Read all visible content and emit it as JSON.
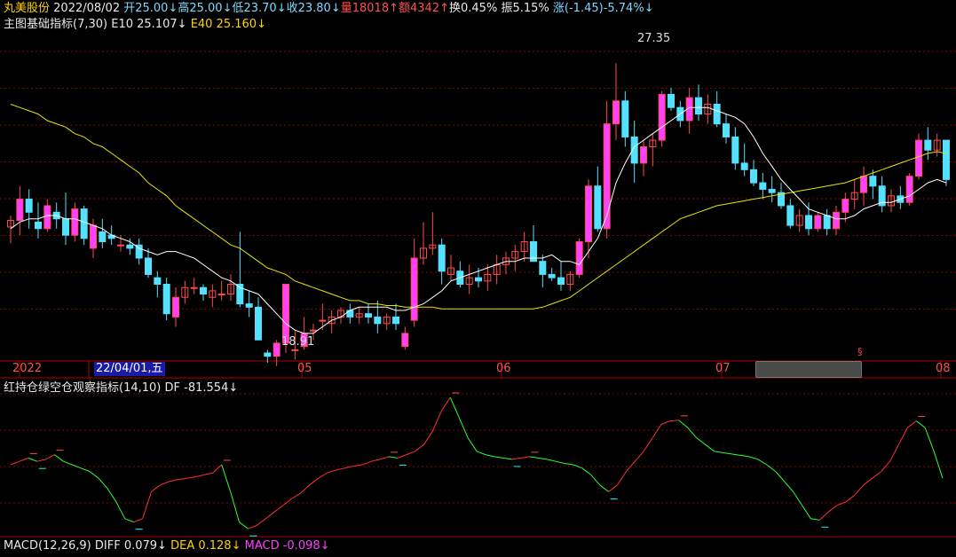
{
  "header": {
    "stock_name": "丸美股份",
    "date": "2022/08/02",
    "open": "开25.00",
    "open_arrow": "↓",
    "high": "高25.00",
    "high_arrow": "↓",
    "low": "低23.70",
    "low_arrow": "↓",
    "close": "收23.80",
    "close_arrow": "↓",
    "volume": "量18018",
    "volume_arrow": "↑",
    "amount": "额4342",
    "amount_arrow": "↑",
    "turnover": "换0.45%",
    "amplitude": "振5.15%",
    "change": "涨(-1.45)-5.74%",
    "change_arrow": "↓"
  },
  "main_indicator": {
    "name": "主图基础指标(7,30)",
    "e10_label": "E10",
    "e10_value": "25.107",
    "e10_arrow": "↓",
    "e40_label": "E40",
    "e40_value": "25.160",
    "e40_arrow": "↓"
  },
  "annotations": {
    "high_label": "27.35",
    "low_label": "18.91",
    "marker": "§"
  },
  "x_axis": {
    "year_label": "2022",
    "cursor_date": "22/04/01,五",
    "month_labels": [
      "05",
      "06",
      "07",
      "08"
    ]
  },
  "sub_indicator": {
    "name": "红持仓绿空仓观察指标(14,10)",
    "df_label": "DF",
    "df_value": "-81.554",
    "df_arrow": "↓"
  },
  "macd": {
    "name": "MACD(12,26,9)",
    "diff_label": "DIFF",
    "diff_value": "0.079",
    "diff_arrow": "↓",
    "dea_label": "DEA",
    "dea_value": "0.128",
    "dea_arrow": "↓",
    "macd_label": "MACD",
    "macd_value": "-0.098",
    "macd_arrow": "↓"
  },
  "colors": {
    "up": "#ff4a4a",
    "down": "#54e0ff",
    "up_fill": "#ff40ff",
    "ma_short": "#ffffff",
    "ma_long": "#e6e600",
    "grid": "#8a0000",
    "osc_up": "#ff3030",
    "osc_down": "#30ff30",
    "dash": "#00ffff"
  },
  "chart_data": [
    {
      "type": "candlestick",
      "title": "丸美股份 主图",
      "y_range": [
        18.5,
        28.2
      ],
      "grid": true,
      "candles": [
        [
          22.35,
          22.7,
          21.85,
          22.55
        ],
        [
          22.55,
          23.6,
          22.1,
          23.2
        ],
        [
          23.2,
          23.5,
          22.3,
          22.8
        ],
        [
          22.5,
          23.1,
          22.0,
          22.3
        ],
        [
          22.3,
          23.2,
          22.2,
          23.0
        ],
        [
          22.8,
          23.1,
          22.3,
          22.6
        ],
        [
          22.6,
          23.4,
          21.8,
          22.1
        ],
        [
          22.1,
          23.1,
          21.9,
          22.9
        ],
        [
          22.9,
          23.0,
          21.8,
          22.0
        ],
        [
          21.7,
          22.6,
          21.4,
          22.4
        ],
        [
          22.2,
          22.6,
          21.7,
          21.9
        ],
        [
          22.1,
          22.4,
          21.8,
          22.0
        ],
        [
          21.8,
          22.1,
          21.6,
          21.8
        ],
        [
          21.8,
          22.0,
          21.5,
          21.7
        ],
        [
          21.8,
          22.0,
          21.2,
          21.4
        ],
        [
          21.4,
          21.7,
          20.8,
          20.9
        ],
        [
          20.8,
          21.0,
          20.2,
          20.6
        ],
        [
          20.6,
          20.8,
          19.5,
          19.7
        ],
        [
          19.6,
          20.5,
          19.3,
          20.2
        ],
        [
          20.2,
          20.7,
          20.0,
          20.5
        ],
        [
          20.5,
          20.8,
          20.3,
          20.5
        ],
        [
          20.5,
          20.6,
          20.1,
          20.3
        ],
        [
          20.2,
          20.6,
          19.9,
          20.4
        ],
        [
          20.3,
          20.7,
          20.1,
          20.3
        ],
        [
          20.3,
          20.9,
          20.1,
          20.6
        ],
        [
          20.6,
          22.2,
          19.9,
          20.0
        ],
        [
          20.0,
          20.4,
          19.6,
          19.9
        ],
        [
          19.9,
          20.2,
          18.9,
          18.9
        ],
        [
          18.5,
          18.6,
          18.2,
          18.4
        ],
        [
          18.4,
          18.9,
          18.1,
          18.8
        ],
        [
          18.8,
          20.6,
          18.5,
          20.6
        ],
        [
          18.6,
          19.2,
          18.3,
          18.6
        ],
        [
          18.7,
          19.6,
          18.6,
          19.1
        ],
        [
          19.2,
          19.4,
          18.9,
          19.2
        ],
        [
          19.5,
          20.0,
          19.2,
          19.5
        ],
        [
          19.4,
          19.8,
          19.1,
          19.6
        ],
        [
          19.6,
          19.9,
          19.4,
          19.8
        ],
        [
          19.8,
          20.0,
          19.4,
          19.6
        ],
        [
          19.6,
          19.9,
          19.4,
          19.7
        ],
        [
          19.7,
          20.0,
          19.4,
          19.6
        ],
        [
          19.6,
          20.1,
          19.1,
          19.4
        ],
        [
          19.4,
          19.7,
          19.2,
          19.6
        ],
        [
          19.6,
          20.0,
          19.2,
          19.4
        ],
        [
          18.7,
          19.3,
          18.6,
          19.1
        ],
        [
          19.5,
          22.0,
          19.3,
          21.4
        ],
        [
          21.4,
          22.5,
          21.2,
          21.7
        ],
        [
          21.7,
          22.8,
          21.5,
          21.8
        ],
        [
          21.8,
          22.0,
          20.6,
          21.0
        ],
        [
          20.9,
          21.5,
          20.7,
          21.1
        ],
        [
          21.0,
          21.3,
          20.5,
          20.6
        ],
        [
          20.6,
          21.2,
          20.3,
          20.8
        ],
        [
          20.8,
          21.1,
          20.5,
          20.7
        ],
        [
          20.7,
          21.2,
          20.4,
          20.9
        ],
        [
          20.9,
          21.5,
          20.6,
          21.2
        ],
        [
          21.2,
          21.6,
          20.9,
          21.4
        ],
        [
          21.4,
          21.8,
          21.0,
          21.6
        ],
        [
          21.6,
          22.2,
          21.3,
          21.9
        ],
        [
          21.9,
          22.4,
          21.4,
          21.3
        ],
        [
          21.3,
          21.5,
          20.5,
          20.9
        ],
        [
          20.9,
          21.1,
          20.7,
          20.8
        ],
        [
          20.8,
          21.3,
          20.4,
          20.6
        ],
        [
          20.6,
          21.0,
          20.4,
          20.9
        ],
        [
          20.9,
          22.0,
          20.8,
          21.9
        ],
        [
          21.9,
          23.8,
          21.4,
          23.6
        ],
        [
          23.6,
          24.2,
          22.2,
          22.3
        ],
        [
          22.3,
          26.2,
          22.0,
          25.5
        ],
        [
          25.5,
          27.35,
          25.0,
          26.2
        ],
        [
          26.2,
          26.5,
          24.8,
          25.1
        ],
        [
          25.1,
          25.6,
          23.7,
          24.3
        ],
        [
          24.3,
          25.0,
          23.9,
          24.8
        ],
        [
          24.8,
          25.2,
          24.2,
          25.0
        ],
        [
          25.0,
          26.5,
          24.8,
          26.4
        ],
        [
          26.4,
          26.6,
          25.9,
          26.0
        ],
        [
          26.0,
          26.2,
          25.4,
          25.6
        ],
        [
          25.6,
          26.6,
          25.2,
          26.3
        ],
        [
          26.3,
          26.7,
          25.6,
          25.8
        ],
        [
          25.8,
          26.4,
          25.5,
          26.1
        ],
        [
          26.1,
          26.5,
          25.4,
          25.5
        ],
        [
          25.5,
          25.8,
          24.9,
          25.1
        ],
        [
          25.1,
          25.4,
          24.1,
          24.3
        ],
        [
          24.3,
          24.9,
          23.9,
          24.1
        ],
        [
          24.1,
          24.4,
          23.6,
          23.7
        ],
        [
          23.7,
          24.0,
          23.2,
          23.5
        ],
        [
          23.5,
          23.9,
          23.1,
          23.4
        ],
        [
          23.4,
          23.7,
          22.9,
          23.0
        ],
        [
          23.0,
          23.2,
          22.3,
          22.4
        ],
        [
          22.4,
          22.9,
          22.2,
          22.7
        ],
        [
          22.7,
          23.1,
          22.1,
          22.3
        ],
        [
          22.3,
          22.8,
          22.2,
          22.7
        ],
        [
          22.7,
          22.9,
          22.1,
          22.3
        ],
        [
          22.3,
          23.0,
          22.1,
          22.8
        ],
        [
          22.8,
          23.4,
          22.5,
          23.2
        ],
        [
          23.2,
          23.8,
          22.9,
          23.4
        ],
        [
          23.4,
          24.2,
          23.0,
          23.9
        ],
        [
          23.9,
          24.1,
          23.2,
          23.6
        ],
        [
          23.6,
          23.9,
          22.8,
          23.0
        ],
        [
          23.0,
          23.5,
          22.8,
          23.3
        ],
        [
          23.3,
          23.6,
          22.9,
          23.1
        ],
        [
          23.1,
          24.0,
          23.0,
          23.9
        ],
        [
          23.9,
          25.2,
          23.8,
          25.0
        ],
        [
          25.0,
          25.4,
          24.4,
          24.7
        ],
        [
          24.7,
          25.2,
          24.5,
          25.0
        ],
        [
          25.0,
          25.0,
          23.6,
          23.8
        ]
      ],
      "ma_short": [
        22.3,
        22.5,
        22.6,
        22.6,
        22.7,
        22.7,
        22.6,
        22.6,
        22.5,
        22.4,
        22.3,
        22.1,
        22.0,
        21.9,
        21.7,
        21.6,
        21.5,
        21.6,
        21.6,
        21.5,
        21.4,
        21.2,
        21.0,
        20.8,
        20.7,
        20.5,
        20.4,
        20.3,
        20.0,
        19.7,
        19.4,
        19.2,
        19.1,
        19.1,
        19.3,
        19.5,
        19.6,
        19.8,
        19.9,
        19.9,
        19.9,
        19.9,
        19.8,
        19.8,
        19.9,
        20.0,
        20.2,
        20.4,
        20.7,
        20.8,
        20.9,
        21.0,
        21.1,
        21.2,
        21.3,
        21.3,
        21.4,
        21.4,
        21.4,
        21.5,
        21.3,
        21.3,
        21.2,
        21.6,
        22.0,
        22.7,
        23.7,
        24.3,
        24.8,
        25.0,
        25.2,
        25.4,
        25.6,
        25.8,
        26.0,
        26.0,
        26.0,
        25.9,
        25.8,
        25.7,
        25.5,
        25.1,
        24.6,
        24.2,
        23.8,
        23.5,
        23.2,
        22.9,
        22.8,
        22.7,
        22.6,
        22.6,
        22.7,
        22.9,
        23.0,
        23.1,
        23.1,
        23.2,
        23.3,
        23.5,
        23.7,
        23.8,
        23.7
      ],
      "ma_long": [
        26.1,
        26.0,
        25.9,
        25.8,
        25.6,
        25.5,
        25.4,
        25.2,
        25.1,
        24.9,
        24.8,
        24.6,
        24.4,
        24.2,
        24.0,
        23.7,
        23.5,
        23.3,
        23.0,
        22.8,
        22.6,
        22.4,
        22.2,
        22.0,
        21.8,
        21.7,
        21.5,
        21.3,
        21.1,
        21.0,
        20.9,
        20.7,
        20.6,
        20.5,
        20.4,
        20.3,
        20.2,
        20.1,
        20.1,
        20.0,
        20.0,
        19.95,
        19.95,
        19.9,
        19.9,
        19.9,
        19.9,
        19.85,
        19.85,
        19.85,
        19.85,
        19.85,
        19.85,
        19.85,
        19.85,
        19.85,
        19.85,
        19.85,
        19.9,
        20.0,
        20.1,
        20.2,
        20.4,
        20.6,
        20.8,
        21.0,
        21.2,
        21.4,
        21.6,
        21.8,
        22.0,
        22.2,
        22.4,
        22.6,
        22.7,
        22.8,
        22.9,
        23.0,
        23.05,
        23.1,
        23.15,
        23.2,
        23.25,
        23.3,
        23.35,
        23.4,
        23.45,
        23.5,
        23.55,
        23.6,
        23.65,
        23.7,
        23.8,
        23.9,
        24.0,
        24.1,
        24.2,
        24.3,
        24.4,
        24.5,
        24.6,
        24.65,
        24.6
      ]
    },
    {
      "type": "line",
      "title": "红持仓绿空仓观察指标(14,10)",
      "y_range": [
        -100,
        100
      ],
      "values": [
        0,
        5,
        10,
        5,
        8,
        15,
        5,
        0,
        -5,
        -10,
        -20,
        -35,
        -55,
        -80,
        -85,
        -80,
        -40,
        -30,
        -25,
        -22,
        -20,
        -18,
        -15,
        -12,
        0,
        -40,
        -85,
        -95,
        -90,
        -80,
        -70,
        -60,
        -50,
        -42,
        -30,
        -20,
        -12,
        -8,
        -5,
        -2,
        0,
        5,
        8,
        12,
        10,
        15,
        20,
        30,
        50,
        80,
        100,
        70,
        40,
        20,
        15,
        12,
        10,
        8,
        10,
        12,
        10,
        8,
        5,
        2,
        0,
        -5,
        -15,
        -30,
        -40,
        -30,
        -10,
        5,
        20,
        40,
        60,
        65,
        66,
        55,
        40,
        30,
        20,
        18,
        16,
        14,
        12,
        8,
        0,
        -10,
        -25,
        -40,
        -60,
        -80,
        -82,
        -70,
        -60,
        -55,
        -45,
        -30,
        -20,
        -10,
        5,
        30,
        55,
        65,
        55,
        20,
        -20
      ]
    }
  ]
}
